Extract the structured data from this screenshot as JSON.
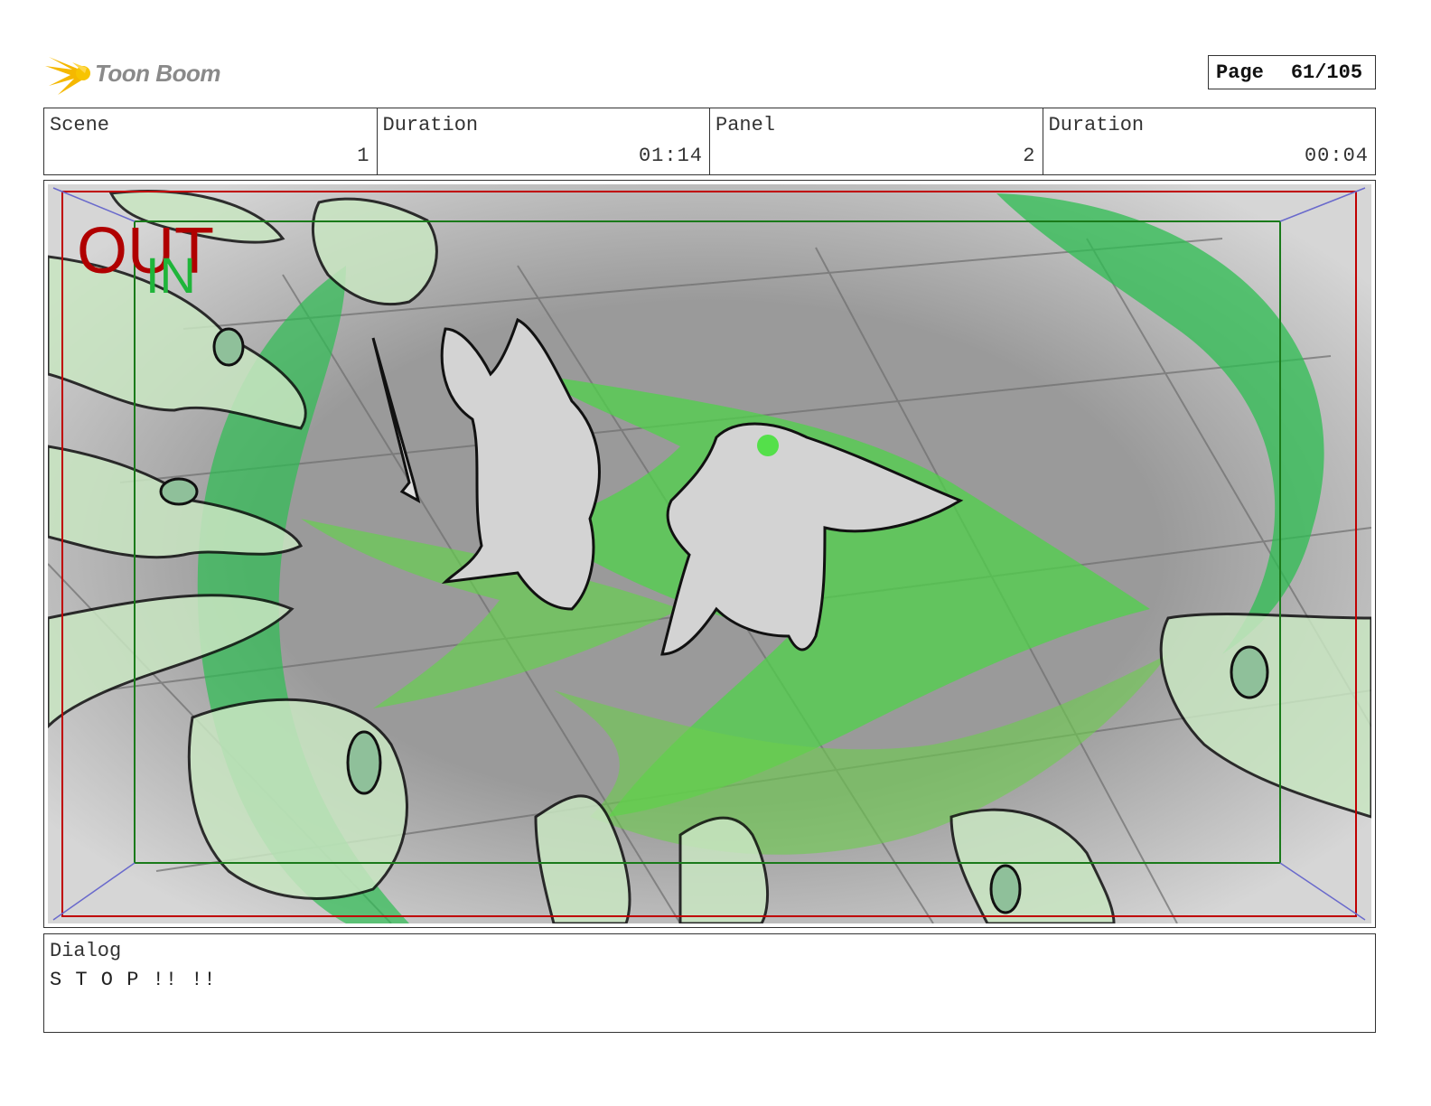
{
  "brand": {
    "name": "Toon Boom",
    "accent_color": "#f5b800",
    "icon": "starburst-logo-icon"
  },
  "page": {
    "label": "Page",
    "number": "61/105"
  },
  "info": {
    "scene_label": "Scene",
    "scene_value": "1",
    "scene_duration_label": "Duration",
    "scene_duration_value": "01:14",
    "panel_label": "Panel",
    "panel_value": "2",
    "panel_duration_label": "Duration",
    "panel_duration_value": "00:04"
  },
  "frame": {
    "out_label": "OUT",
    "in_label": "IN",
    "out_color": "#b00000",
    "in_color": "#1fb53a"
  },
  "dialog": {
    "label": "Dialog",
    "text": "S T O P !! !!"
  }
}
